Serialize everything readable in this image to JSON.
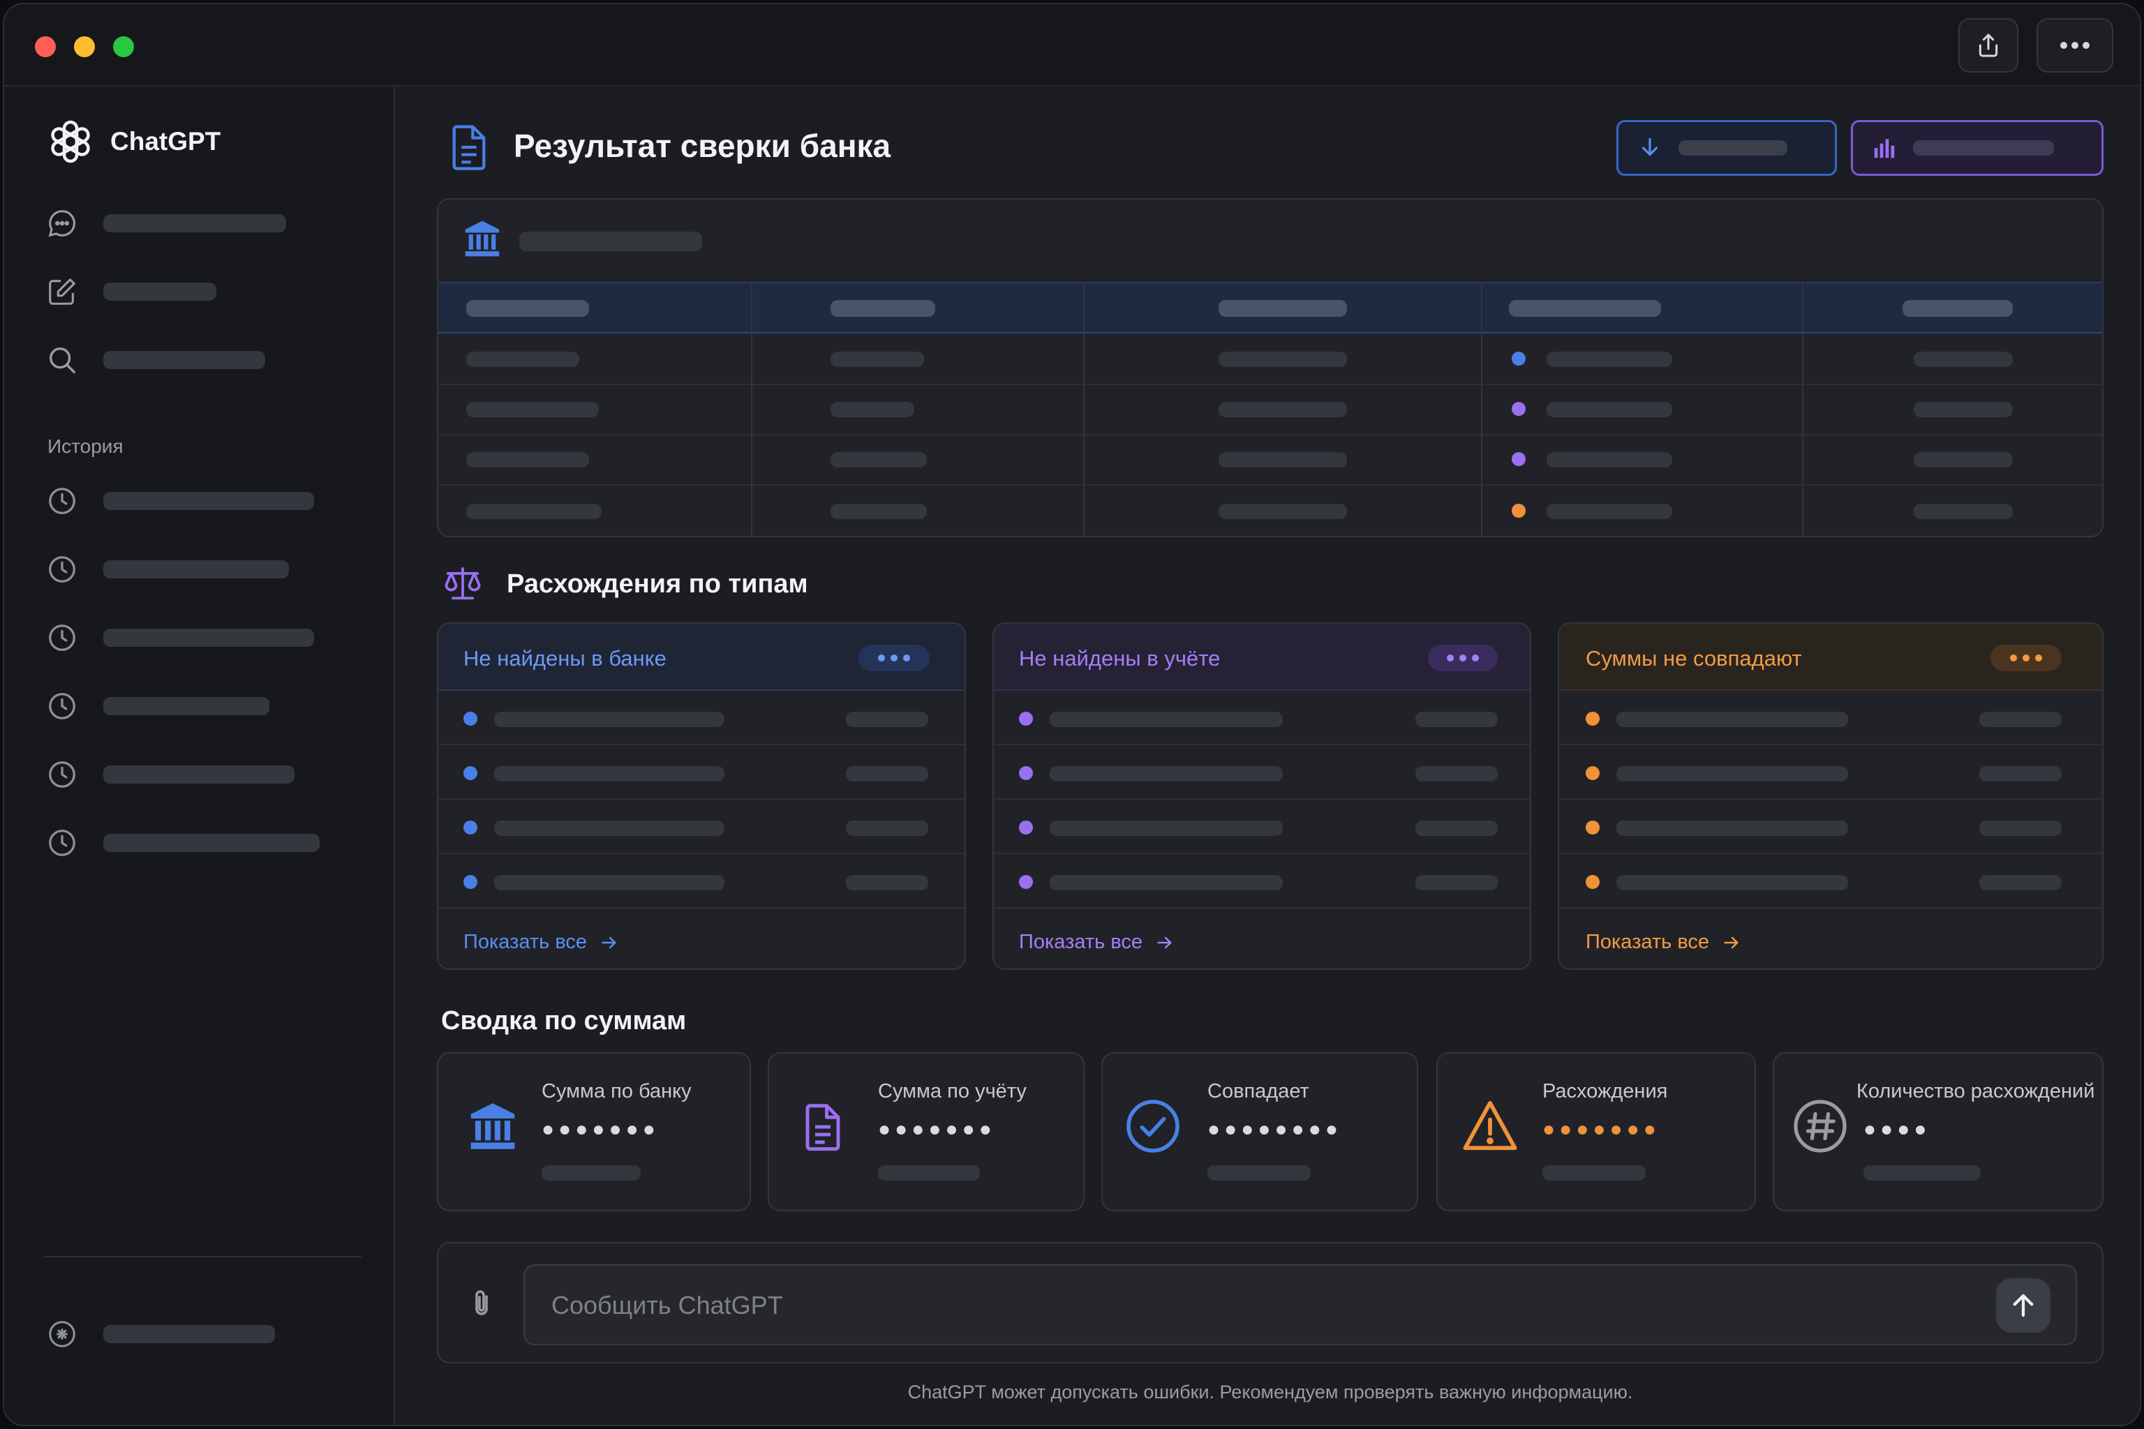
{
  "app": {
    "name": "ChatGPT"
  },
  "titlebar": {
    "share_icon": "share-icon",
    "more_icon": "more-icon"
  },
  "sidebar": {
    "brand": "ChatGPT",
    "history_label": "История"
  },
  "header": {
    "title": "Результат сверки банка"
  },
  "discrepancies": {
    "title": "Расхождения по типам",
    "cards": [
      {
        "title": "Не найдены в банке",
        "link": "Показать все",
        "color": "#4a7fe6"
      },
      {
        "title": "Не найдены в учёте",
        "link": "Показать все",
        "color": "#9a6ff0"
      },
      {
        "title": "Суммы не совпадают",
        "link": "Показать все",
        "color": "#f0923a"
      }
    ]
  },
  "summary": {
    "title": "Сводка по суммам",
    "cards": [
      {
        "label": "Сумма по банку",
        "masked": "●●●●●●●",
        "icon": "bank-icon"
      },
      {
        "label": "Сумма по учёту",
        "masked": "●●●●●●●",
        "icon": "document-icon"
      },
      {
        "label": "Совпадает",
        "masked": "●●●●●●●●",
        "icon": "check-circle-icon"
      },
      {
        "label": "Расхождения",
        "masked": "●●●●●●●",
        "icon": "warning-icon"
      },
      {
        "label": "Количество расхождений",
        "masked": "●●●●",
        "icon": "hash-icon"
      }
    ]
  },
  "composer": {
    "placeholder": "Сообщить ChatGPT"
  },
  "footer": {
    "disclaimer": "ChatGPT может допускать ошибки. Рекомендуем проверять важную информацию."
  },
  "colors": {
    "blue": "#4a7fe6",
    "purple": "#9a6ff0",
    "orange": "#f0923a",
    "gray": "#8e9198"
  }
}
